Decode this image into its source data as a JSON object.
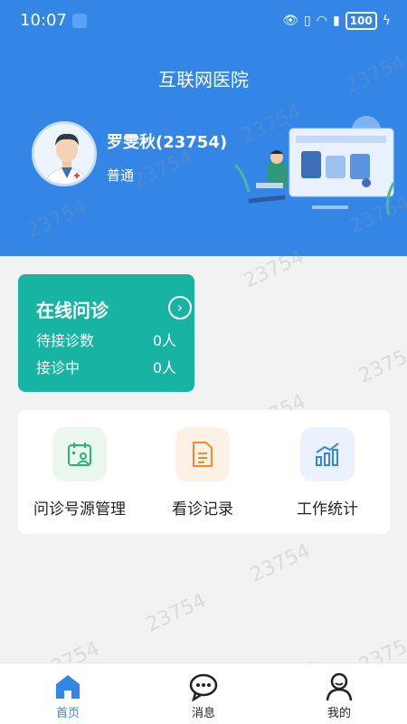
{
  "status": {
    "time": "10:07",
    "battery": "100"
  },
  "header": {
    "title": "互联网医院",
    "user_name": "罗雯秋(23754)",
    "user_level": "普通"
  },
  "online_consult": {
    "title": "在线问诊",
    "pending_label": "待接诊数",
    "pending_value": "0人",
    "in_progress_label": "接诊中",
    "in_progress_value": "0人"
  },
  "quick_actions": [
    {
      "label": "问诊号源管理",
      "icon": "calendar-user-icon",
      "color": "#2ab27b"
    },
    {
      "label": "看诊记录",
      "icon": "document-icon",
      "color": "#f08c2e"
    },
    {
      "label": "工作统计",
      "icon": "bar-chart-icon",
      "color": "#3386e6"
    }
  ],
  "tabbar": [
    {
      "label": "首页",
      "icon": "home-icon",
      "active": true
    },
    {
      "label": "消息",
      "icon": "chat-icon",
      "active": false
    },
    {
      "label": "我的",
      "icon": "user-icon",
      "active": false
    }
  ],
  "watermark": "23754",
  "colors": {
    "primary": "#3386e6",
    "teal": "#17b3a3",
    "background": "#f2f2f2"
  }
}
